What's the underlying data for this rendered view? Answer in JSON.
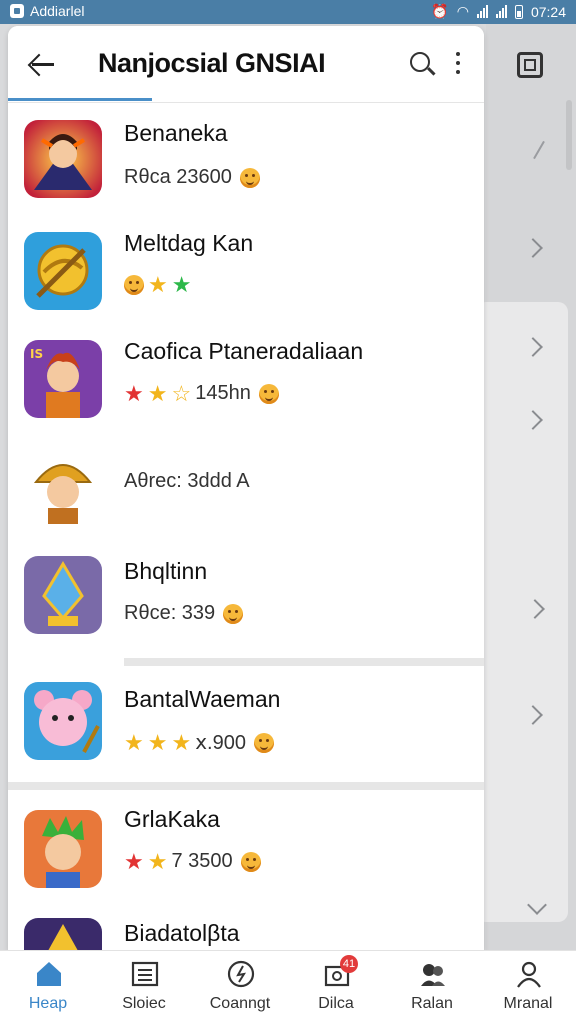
{
  "status_bar": {
    "app_label": "Addiarlel",
    "time": "07:24"
  },
  "app_bar": {
    "title": "Nanjocsial GNSIAI"
  },
  "items": [
    {
      "name": "Benaneka",
      "meta": "Rθca  23600",
      "stars": []
    },
    {
      "name": "Meltdag Kan",
      "meta": "",
      "stars": [
        "face",
        "gold",
        "green"
      ]
    },
    {
      "name": "Caofica Ptaneradaliaan",
      "meta": "145hn",
      "stars": [
        "red",
        "gold",
        "gold-half"
      ]
    },
    {
      "name": "",
      "meta": "Aθrec: 3ddd A",
      "stars": []
    },
    {
      "name": "Bhqltinn",
      "meta": "Rθce: 339",
      "stars": []
    },
    {
      "name": "BantalWaeman",
      "meta": "ⅹ.900",
      "stars": [
        "gold",
        "gold",
        "gold-half"
      ]
    },
    {
      "name": "GrlaKaka",
      "meta": "7 3500",
      "stars": [
        "red",
        "gold-half"
      ]
    },
    {
      "name": "Biadatolβta",
      "meta": "",
      "stars": []
    }
  ],
  "bottom_nav": [
    {
      "label": "Heap",
      "icon": "home-icon",
      "active": true
    },
    {
      "label": "Sloiec",
      "icon": "list-icon"
    },
    {
      "label": "Coanngt",
      "icon": "clock-icon"
    },
    {
      "label": "Dilca",
      "icon": "inbox-icon",
      "badge": "41"
    },
    {
      "label": "Ralan",
      "icon": "users-icon"
    },
    {
      "label": "Mranal",
      "icon": "profile-icon"
    }
  ],
  "colors": {
    "accent": "#3a86c8",
    "status_bar": "#4a7ea6",
    "star_gold": "#f2b51c",
    "star_red": "#e23434",
    "star_green": "#2db84a"
  }
}
